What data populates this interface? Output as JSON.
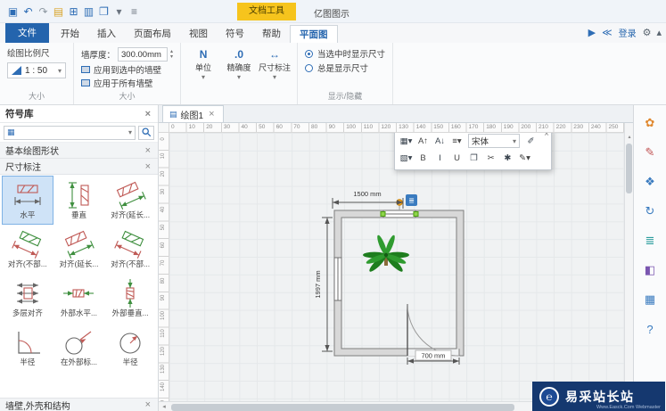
{
  "ui": {
    "close": "×",
    "dropdown": "▾",
    "spin_up": "▴",
    "spin_down": "▾",
    "filter": "▦"
  },
  "titlebar": {
    "quick_icons": [
      {
        "name": "save-icon",
        "glyph": "▣",
        "color": "#2e6db5"
      },
      {
        "name": "undo-icon",
        "glyph": "↶",
        "color": "#2e6db5"
      },
      {
        "name": "redo-icon",
        "glyph": "↷",
        "color": "#8e99a3"
      },
      {
        "name": "open-icon",
        "glyph": "▤",
        "color": "#d9a62e"
      },
      {
        "name": "new-icon",
        "glyph": "⊞",
        "color": "#2e6db5"
      },
      {
        "name": "print-icon",
        "glyph": "▥",
        "color": "#2e6db5"
      },
      {
        "name": "window-icon",
        "glyph": "❐",
        "color": "#2e6db5"
      },
      {
        "name": "more-icon",
        "glyph": "▾",
        "color": "#6b7480"
      },
      {
        "name": "menu-icon",
        "glyph": "≡",
        "color": "#6b7480"
      }
    ],
    "doc_tools": "文档工具",
    "app_title": "亿图图示"
  },
  "ribbon": {
    "tabs": [
      {
        "label": "文件",
        "type": "file"
      },
      {
        "label": "开始"
      },
      {
        "label": "插入"
      },
      {
        "label": "页面布局"
      },
      {
        "label": "视图"
      },
      {
        "label": "符号"
      },
      {
        "label": "帮助"
      },
      {
        "label": "平面图",
        "type": "active"
      }
    ],
    "login": "登录",
    "right_icons": [
      {
        "name": "presentation-icon",
        "glyph": "▶",
        "color": "#2e6db5"
      },
      {
        "name": "share-icon",
        "glyph": "≪",
        "color": "#2e6db5"
      }
    ],
    "right_icons2": [
      {
        "name": "settings-gear-icon",
        "glyph": "⚙",
        "color": "#5a6570"
      },
      {
        "name": "collapse-ribbon-icon",
        "glyph": "▴",
        "color": "#5a6570"
      }
    ],
    "scale_group": {
      "title": "绘图比例尺",
      "value": "1 : 50",
      "label": "大小"
    },
    "wall_group": {
      "thickness_label": "墙厚度：",
      "thickness_value": "300.00mm",
      "apply_selected": "应用到选中的墙壁",
      "apply_all": "应用于所有墙壁",
      "label": "大小"
    },
    "dim_group": {
      "buttons": [
        {
          "name": "unit-button",
          "label": "单位",
          "glyph": "N",
          "color": "#2e6db5"
        },
        {
          "name": "precision-button",
          "label": "精确度",
          "glyph": ".0",
          "color": "#2e6db5"
        },
        {
          "name": "dimension-style-button",
          "label": "尺寸标注",
          "glyph": "↔",
          "color": "#2e6db5"
        }
      ],
      "radio1": "当选中时显示尺寸",
      "radio2": "总是显示尺寸",
      "label": "显示/隐藏"
    }
  },
  "sidebar": {
    "title": "符号库",
    "section_basic": "基本绘图形状",
    "section_dim": "尺寸标注",
    "bottom_section": "墙壁,外壳和结构",
    "symbols": [
      {
        "label": "水平",
        "icon": "horiz",
        "selected": true
      },
      {
        "label": "垂直",
        "icon": "vert"
      },
      {
        "label": "对齐(延长...",
        "icon": "align"
      },
      {
        "label": "对齐(不部...",
        "icon": "align2"
      },
      {
        "label": "对齐(延长...",
        "icon": "align"
      },
      {
        "label": "对齐(不部...",
        "icon": "align2"
      },
      {
        "label": "多层对齐",
        "icon": "multi"
      },
      {
        "label": "外部水平...",
        "icon": "exth"
      },
      {
        "label": "外部垂直...",
        "icon": "extv"
      },
      {
        "label": "半径",
        "icon": "angle"
      },
      {
        "label": "在外部标...",
        "icon": "radiusext"
      },
      {
        "label": "半径",
        "icon": "radius"
      }
    ]
  },
  "canvas": {
    "tab": "绘图1",
    "h_ruler": {
      "start": 0,
      "end": 260,
      "step": 10
    },
    "v_ruler": {
      "start": 0,
      "end": 150,
      "step": 10
    },
    "toolbar": {
      "font": "宋体",
      "row1": [
        {
          "name": "border-style-icon",
          "glyph": "▦▾"
        },
        {
          "name": "font-increase-icon",
          "glyph": "A↑"
        },
        {
          "name": "font-decrease-icon",
          "glyph": "A↓"
        },
        {
          "name": "align-text-icon",
          "glyph": "≡▾"
        }
      ],
      "row1b": [
        {
          "name": "format-painter-icon",
          "glyph": "✐"
        }
      ],
      "row2": [
        {
          "name": "fill-style-icon",
          "glyph": "▧▾"
        },
        {
          "name": "bold-button",
          "glyph": "B"
        },
        {
          "name": "italic-button",
          "glyph": "I"
        },
        {
          "name": "underline-button",
          "glyph": "U"
        },
        {
          "name": "copy-icon",
          "glyph": "❐"
        },
        {
          "name": "cut-icon",
          "glyph": "✂"
        },
        {
          "name": "tools-icon",
          "glyph": "✱"
        },
        {
          "name": "pen-icon",
          "glyph": "✎▾"
        }
      ]
    },
    "dims": {
      "top": "1500 mm",
      "left": "1997 mm",
      "bottom": "700 mm"
    }
  },
  "right_strip": {
    "icons": [
      {
        "name": "clipart-icon",
        "glyph": "✿",
        "color": "#e0882e"
      },
      {
        "name": "pen-panel-icon",
        "glyph": "✎",
        "color": "#c05050"
      },
      {
        "name": "symbols-panel-icon",
        "glyph": "❖",
        "color": "#3a7bbf"
      },
      {
        "name": "history-icon",
        "glyph": "↻",
        "color": "#3a7bbf"
      },
      {
        "name": "layers-icon",
        "glyph": "≣",
        "color": "#2e9e9e"
      },
      {
        "name": "theme-icon",
        "glyph": "◧",
        "color": "#7a56b0"
      },
      {
        "name": "task-pane-icon",
        "glyph": "▦",
        "color": "#3a7bbf"
      },
      {
        "name": "help-icon",
        "glyph": "?",
        "color": "#3a7bbf"
      }
    ]
  },
  "watermark": {
    "logo_glyph": "℮",
    "title": "易采站长站",
    "subtitle": "Www.Easck.Com Webmaster"
  }
}
